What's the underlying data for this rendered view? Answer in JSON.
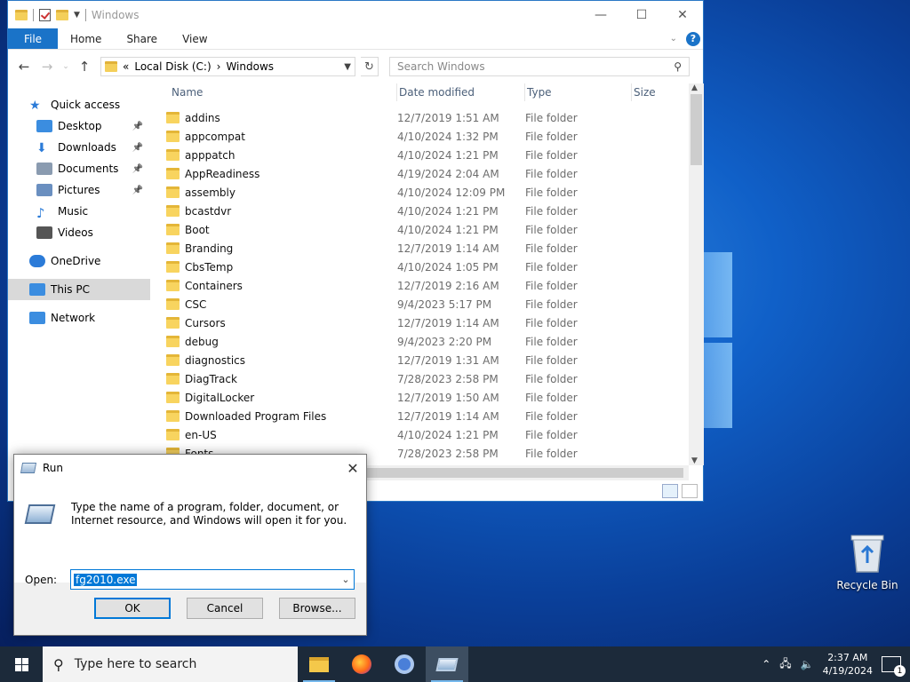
{
  "explorer": {
    "title": "Windows",
    "ribbon": {
      "file": "File",
      "tabs": [
        "Home",
        "Share",
        "View"
      ]
    },
    "address": {
      "prefix": "«",
      "parts": [
        "Local Disk (C:)",
        "Windows"
      ],
      "sep": "›"
    },
    "search_placeholder": "Search Windows",
    "nav": [
      {
        "label": "Quick access",
        "icon": "star-icon",
        "indent": 1
      },
      {
        "label": "Desktop",
        "icon": "desktop-icon",
        "indent": 2,
        "pinned": true
      },
      {
        "label": "Downloads",
        "icon": "download-icon",
        "indent": 2,
        "pinned": true
      },
      {
        "label": "Documents",
        "icon": "document-icon",
        "indent": 2,
        "pinned": true
      },
      {
        "label": "Pictures",
        "icon": "picture-icon",
        "indent": 2,
        "pinned": true
      },
      {
        "label": "Music",
        "icon": "music-icon",
        "indent": 2
      },
      {
        "label": "Videos",
        "icon": "video-icon",
        "indent": 2
      },
      {
        "label": "OneDrive",
        "icon": "cloud-icon",
        "indent": 1
      },
      {
        "label": "This PC",
        "icon": "computer-icon",
        "indent": 1,
        "selected": true
      },
      {
        "label": "Network",
        "icon": "network-icon",
        "indent": 1
      }
    ],
    "columns": [
      "Name",
      "Date modified",
      "Type",
      "Size"
    ],
    "files": [
      {
        "name": "addins",
        "date": "12/7/2019 1:51 AM",
        "type": "File folder"
      },
      {
        "name": "appcompat",
        "date": "4/10/2024 1:32 PM",
        "type": "File folder"
      },
      {
        "name": "apppatch",
        "date": "4/10/2024 1:21 PM",
        "type": "File folder"
      },
      {
        "name": "AppReadiness",
        "date": "4/19/2024 2:04 AM",
        "type": "File folder"
      },
      {
        "name": "assembly",
        "date": "4/10/2024 12:09 PM",
        "type": "File folder"
      },
      {
        "name": "bcastdvr",
        "date": "4/10/2024 1:21 PM",
        "type": "File folder"
      },
      {
        "name": "Boot",
        "date": "4/10/2024 1:21 PM",
        "type": "File folder"
      },
      {
        "name": "Branding",
        "date": "12/7/2019 1:14 AM",
        "type": "File folder"
      },
      {
        "name": "CbsTemp",
        "date": "4/10/2024 1:05 PM",
        "type": "File folder"
      },
      {
        "name": "Containers",
        "date": "12/7/2019 2:16 AM",
        "type": "File folder"
      },
      {
        "name": "CSC",
        "date": "9/4/2023 5:17 PM",
        "type": "File folder"
      },
      {
        "name": "Cursors",
        "date": "12/7/2019 1:14 AM",
        "type": "File folder"
      },
      {
        "name": "debug",
        "date": "9/4/2023 2:20 PM",
        "type": "File folder"
      },
      {
        "name": "diagnostics",
        "date": "12/7/2019 1:31 AM",
        "type": "File folder"
      },
      {
        "name": "DiagTrack",
        "date": "7/28/2023 2:58 PM",
        "type": "File folder"
      },
      {
        "name": "DigitalLocker",
        "date": "12/7/2019 1:50 AM",
        "type": "File folder"
      },
      {
        "name": "Downloaded Program Files",
        "date": "12/7/2019 1:14 AM",
        "type": "File folder"
      },
      {
        "name": "en-US",
        "date": "4/10/2024 1:21 PM",
        "type": "File folder"
      },
      {
        "name": "Fonts",
        "date": "7/28/2023 2:58 PM",
        "type": "File folder"
      }
    ]
  },
  "run": {
    "title": "Run",
    "description": "Type the name of a program, folder, document, or Internet resource, and Windows will open it for you.",
    "open_label": "Open:",
    "open_value": "fg2010.exe",
    "buttons": {
      "ok": "OK",
      "cancel": "Cancel",
      "browse": "Browse..."
    }
  },
  "desktop": {
    "recycle_bin": "Recycle Bin"
  },
  "taskbar": {
    "search_placeholder": "Type here to search",
    "time": "2:37 AM",
    "date": "4/19/2024",
    "notification_count": "1"
  },
  "colors": {
    "accent": "#0078d7",
    "file_tab": "#1a73c8",
    "taskbar": "#1c2a3a"
  }
}
